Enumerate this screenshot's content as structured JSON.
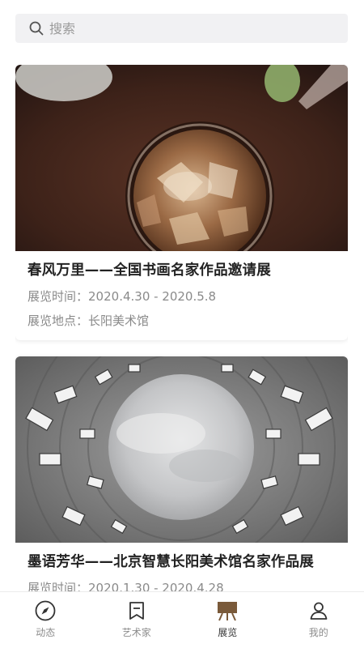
{
  "search": {
    "placeholder": "搜索"
  },
  "exhibitions": [
    {
      "title": "春风万里——全国书画名家作品邀请展",
      "time_label": "展览时间：",
      "time_value": "2020.4.30 - 2020.5.8",
      "place_label": "展览地点：",
      "place_value": "长阳美术馆",
      "image": "iced-coffee-photo"
    },
    {
      "title": "墨语芳华——北京智慧长阳美术馆名家作品展",
      "time_label": "展览时间：",
      "time_value": "2020.1.30 - 2020.4.28",
      "image": "circular-building-sky-photo"
    }
  ],
  "tabbar": {
    "active_color": "#7a5a3a",
    "items": [
      {
        "label": "动态",
        "icon": "compass-icon",
        "active": false
      },
      {
        "label": "艺术家",
        "icon": "bookmark-icon",
        "active": false
      },
      {
        "label": "展览",
        "icon": "easel-icon",
        "active": true
      },
      {
        "label": "我的",
        "icon": "user-icon",
        "active": false
      }
    ]
  }
}
